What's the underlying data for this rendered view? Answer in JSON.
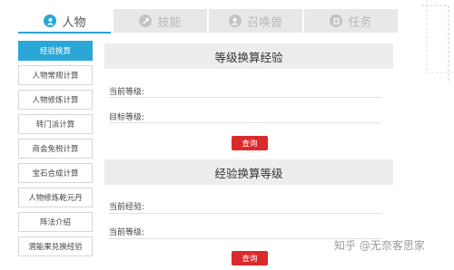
{
  "tabs": [
    {
      "label": "人物",
      "icon": "person-icon",
      "active": true
    },
    {
      "label": "技能",
      "icon": "skill-icon",
      "active": false
    },
    {
      "label": "召唤兽",
      "icon": "summon-beast-icon",
      "active": false
    },
    {
      "label": "任务",
      "icon": "task-icon",
      "active": false
    }
  ],
  "sidebar": {
    "items": [
      {
        "label": "经验换算",
        "active": true
      },
      {
        "label": "人物常规计算",
        "active": false
      },
      {
        "label": "人物修炼计算",
        "active": false
      },
      {
        "label": "转门派计算",
        "active": false
      },
      {
        "label": "商会免税计算",
        "active": false
      },
      {
        "label": "宝石合成计算",
        "active": false
      },
      {
        "label": "人物修炼乾元丹",
        "active": false
      },
      {
        "label": "阵法介绍",
        "active": false
      },
      {
        "label": "潜能果兑换经验",
        "active": false
      }
    ]
  },
  "section1": {
    "title": "等级换算经验",
    "current_level_label": "当前等级:",
    "target_level_label": "目标等级:",
    "query_label": "查询"
  },
  "section2": {
    "title": "经验换算等级",
    "current_exp_label": "当前经验:",
    "current_level_label": "当前等级:",
    "query_label": "查询"
  },
  "watermark": "知乎 @无奈客思家",
  "colors": {
    "accent": "#2aa7d6",
    "button": "#d92b2b",
    "tab_bg": "#e8e8e8",
    "header_bg": "#ededed"
  }
}
